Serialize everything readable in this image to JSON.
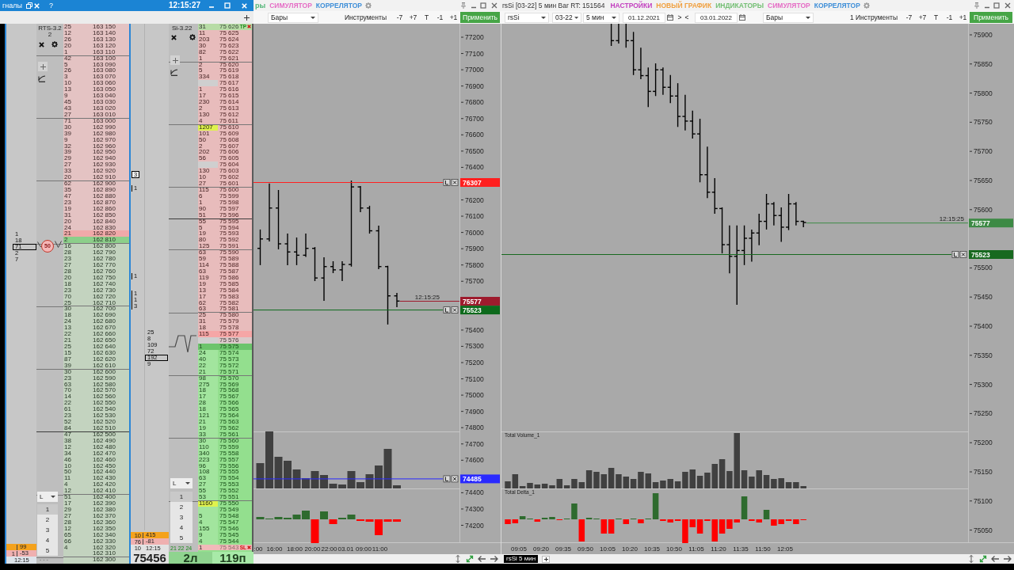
{
  "dom_window": {
    "title": "гналы",
    "help": "?",
    "clock": "12:15:27",
    "left_strip": {
      "cluster": [
        {
          "value": "1",
          "selected": false
        },
        {
          "value": "18",
          "selected": false
        },
        {
          "value": "71",
          "selected": true
        },
        {
          "value": "2",
          "selected": false
        },
        {
          "value": "7",
          "selected": false
        }
      ],
      "totals": [
        {
          "kind": "buy",
          "value": "99"
        },
        {
          "kind": "sell",
          "count": "1",
          "value": "-53"
        }
      ],
      "time": "12:15"
    },
    "rts": {
      "instrument": "RTS-3.22",
      "badge": "50",
      "mode": "L",
      "levels": [
        {
          "label": "1",
          "selected": true
        },
        {
          "label": "2",
          "selected": false
        },
        {
          "label": "3",
          "selected": false
        },
        {
          "label": "4",
          "selected": false
        },
        {
          "label": "5",
          "selected": false
        }
      ],
      "footer": "- - -",
      "ladder": {
        "active": false,
        "rows": [
          {
            "volume": "25",
            "price": "163 150",
            "kind": "ask"
          },
          {
            "volume": "12",
            "price": "163 140",
            "kind": "ask"
          },
          {
            "volume": "26",
            "price": "163 130",
            "kind": "ask"
          },
          {
            "volume": "20",
            "price": "163 120",
            "kind": "ask"
          },
          {
            "volume": "1",
            "price": "163 110",
            "kind": "ask"
          },
          {
            "volume": "42",
            "price": "163 100",
            "kind": "ask"
          },
          {
            "volume": "5",
            "price": "163 090",
            "kind": "ask"
          },
          {
            "volume": "26",
            "price": "163 080",
            "kind": "ask"
          },
          {
            "volume": "3",
            "price": "163 070",
            "kind": "ask"
          },
          {
            "volume": "10",
            "price": "163 060",
            "kind": "ask"
          },
          {
            "volume": "13",
            "price": "163 050",
            "kind": "ask"
          },
          {
            "volume": "9",
            "price": "163 040",
            "kind": "ask"
          },
          {
            "volume": "45",
            "price": "163 030",
            "kind": "ask"
          },
          {
            "volume": "43",
            "price": "163 020",
            "kind": "ask"
          },
          {
            "volume": "27",
            "price": "163 010",
            "kind": "ask"
          },
          {
            "volume": "71",
            "price": "163 000",
            "kind": "ask"
          },
          {
            "volume": "30",
            "price": "162 990",
            "kind": "ask"
          },
          {
            "volume": "39",
            "price": "162 980",
            "kind": "ask"
          },
          {
            "volume": "9",
            "price": "162 970",
            "kind": "ask"
          },
          {
            "volume": "32",
            "price": "162 960",
            "kind": "ask"
          },
          {
            "volume": "39",
            "price": "162 950",
            "kind": "ask"
          },
          {
            "volume": "29",
            "price": "162 940",
            "kind": "ask"
          },
          {
            "volume": "27",
            "price": "162 930",
            "kind": "ask"
          },
          {
            "volume": "33",
            "price": "162 920",
            "kind": "ask"
          },
          {
            "volume": "20",
            "price": "162 910",
            "kind": "ask"
          },
          {
            "volume": "62",
            "price": "162 900",
            "kind": "ask"
          },
          {
            "volume": "35",
            "price": "162 890",
            "kind": "ask"
          },
          {
            "volume": "47",
            "price": "162 880",
            "kind": "ask"
          },
          {
            "volume": "23",
            "price": "162 870",
            "kind": "ask"
          },
          {
            "volume": "19",
            "price": "162 860",
            "kind": "ask"
          },
          {
            "volume": "31",
            "price": "162 850",
            "kind": "ask"
          },
          {
            "volume": "20",
            "price": "162 840",
            "kind": "ask"
          },
          {
            "volume": "24",
            "price": "162 830",
            "kind": "ask"
          },
          {
            "volume": "21",
            "price": "162 820",
            "kind": "best_ask"
          },
          {
            "volume": "2",
            "price": "162 810",
            "kind": "best_bid"
          },
          {
            "volume": "16",
            "price": "162 800",
            "kind": "bid"
          },
          {
            "volume": "28",
            "price": "162 790",
            "kind": "bid"
          },
          {
            "volume": "23",
            "price": "162 780",
            "kind": "bid"
          },
          {
            "volume": "27",
            "price": "162 770",
            "kind": "bid"
          },
          {
            "volume": "28",
            "price": "162 760",
            "kind": "bid"
          },
          {
            "volume": "20",
            "price": "162 750",
            "kind": "bid"
          },
          {
            "volume": "18",
            "price": "162 740",
            "kind": "bid"
          },
          {
            "volume": "23",
            "price": "162 730",
            "kind": "bid"
          },
          {
            "volume": "70",
            "price": "162 720",
            "kind": "bid"
          },
          {
            "volume": "25",
            "price": "162 710",
            "kind": "bid"
          },
          {
            "volume": "30",
            "price": "162 700",
            "kind": "bid"
          },
          {
            "volume": "18",
            "price": "162 690",
            "kind": "bid"
          },
          {
            "volume": "24",
            "price": "162 680",
            "kind": "bid"
          },
          {
            "volume": "13",
            "price": "162 670",
            "kind": "bid"
          },
          {
            "volume": "22",
            "price": "162 660",
            "kind": "bid"
          },
          {
            "volume": "21",
            "price": "162 650",
            "kind": "bid"
          },
          {
            "volume": "25",
            "price": "162 640",
            "kind": "bid"
          },
          {
            "volume": "15",
            "price": "162 630",
            "kind": "bid"
          },
          {
            "volume": "87",
            "price": "162 620",
            "kind": "bid"
          },
          {
            "volume": "39",
            "price": "162 610",
            "kind": "bid"
          },
          {
            "volume": "30",
            "price": "162 600",
            "kind": "bid"
          },
          {
            "volume": "23",
            "price": "162 590",
            "kind": "bid"
          },
          {
            "volume": "63",
            "price": "162 580",
            "kind": "bid"
          },
          {
            "volume": "70",
            "price": "162 570",
            "kind": "bid"
          },
          {
            "volume": "14",
            "price": "162 560",
            "kind": "bid"
          },
          {
            "volume": "22",
            "price": "162 550",
            "kind": "bid"
          },
          {
            "volume": "61",
            "price": "162 540",
            "kind": "bid"
          },
          {
            "volume": "23",
            "price": "162 530",
            "kind": "bid"
          },
          {
            "volume": "52",
            "price": "162 520",
            "kind": "bid"
          },
          {
            "volume": "84",
            "price": "162 510",
            "kind": "bid"
          },
          {
            "volume": "47",
            "price": "162 500",
            "kind": "bid"
          },
          {
            "volume": "38",
            "price": "162 490",
            "kind": "bid"
          },
          {
            "volume": "12",
            "price": "162 480",
            "kind": "bid"
          },
          {
            "volume": "34",
            "price": "162 470",
            "kind": "bid"
          },
          {
            "volume": "46",
            "price": "162 460",
            "kind": "bid"
          },
          {
            "volume": "10",
            "price": "162 450",
            "kind": "bid"
          },
          {
            "volume": "50",
            "price": "162 440",
            "kind": "bid"
          },
          {
            "volume": "11",
            "price": "162 430",
            "kind": "bid"
          },
          {
            "volume": "4",
            "price": "162 420",
            "kind": "bid"
          },
          {
            "volume": "12",
            "price": "162 410",
            "kind": "bid"
          },
          {
            "volume": "51",
            "price": "162 400",
            "kind": "bid"
          },
          {
            "volume": "17",
            "price": "162 390",
            "kind": "bid"
          },
          {
            "volume": "29",
            "price": "162 380",
            "kind": "bid"
          },
          {
            "volume": "27",
            "price": "162 370",
            "kind": "bid"
          },
          {
            "volume": "28",
            "price": "162 360",
            "kind": "bid"
          },
          {
            "volume": "12",
            "price": "162 350",
            "kind": "bid"
          },
          {
            "volume": "65",
            "price": "162 340",
            "kind": "bid"
          },
          {
            "volume": "66",
            "price": "162 330",
            "kind": "bid"
          },
          {
            "volume": "4",
            "price": "162 320",
            "kind": "bid"
          },
          {
            "price": "162 310",
            "kind": "bid"
          },
          {
            "price": "162 300",
            "kind": "bid"
          }
        ]
      }
    },
    "tape": {
      "items": [
        {
          "value": "3",
          "selected": true
        },
        {
          "value": "1",
          "selected": false
        },
        {
          "value": "1",
          "selected": false
        },
        {
          "value": "1",
          "selected": false
        },
        {
          "value": "1",
          "selected": false
        },
        {
          "value": "3",
          "selected": false
        }
      ],
      "cluster": [
        {
          "value": "25",
          "selected": false
        },
        {
          "value": "8",
          "selected": false
        },
        {
          "value": "109",
          "selected": false
        },
        {
          "value": "72",
          "selected": false
        },
        {
          "value": "192",
          "selected": true
        },
        {
          "value": "9",
          "selected": false
        }
      ],
      "totals": [
        {
          "kind": "buy",
          "count": "10",
          "value": "415"
        },
        {
          "kind": "sell",
          "count": "76",
          "value": "-81"
        }
      ],
      "count": "10",
      "time": "12:15",
      "last_price": "75456"
    },
    "si": {
      "instrument": "Si-3.22",
      "mode": "L",
      "levels": [
        {
          "label": "1",
          "selected": true
        },
        {
          "label": "2",
          "selected": false
        },
        {
          "label": "3",
          "selected": false
        },
        {
          "label": "4",
          "selected": false
        },
        {
          "label": "5",
          "selected": false
        }
      ],
      "footer": "21 22 24",
      "ladder": {
        "active": true,
        "rows": [
          {
            "volume": "31",
            "price": "75 626",
            "kind": "ask",
            "order": {
              "kind": "take_profit",
              "label": "TP"
            }
          },
          {
            "volume": "11",
            "price": "75 625",
            "kind": "ask"
          },
          {
            "volume": "203",
            "price": "75 624",
            "kind": "ask"
          },
          {
            "volume": "30",
            "price": "75 623",
            "kind": "ask"
          },
          {
            "volume": "82",
            "price": "75 622",
            "kind": "ask"
          },
          {
            "volume": "1",
            "price": "75 621",
            "kind": "ask"
          },
          {
            "volume": "2",
            "price": "75 620",
            "kind": "ask"
          },
          {
            "volume": "5",
            "price": "75 619",
            "kind": "ask"
          },
          {
            "volume": "334",
            "price": "75 618",
            "kind": "ask"
          },
          {
            "price": "75 617",
            "kind": "ask"
          },
          {
            "volume": "1",
            "price": "75 616",
            "kind": "ask"
          },
          {
            "volume": "17",
            "price": "75 615",
            "kind": "ask"
          },
          {
            "volume": "230",
            "price": "75 614",
            "kind": "ask"
          },
          {
            "volume": "2",
            "price": "75 613",
            "kind": "ask"
          },
          {
            "volume": "130",
            "price": "75 612",
            "kind": "ask"
          },
          {
            "volume": "4",
            "price": "75 611",
            "kind": "ask"
          },
          {
            "volume": "1207",
            "price": "75 610",
            "kind": "big_ask"
          },
          {
            "volume": "101",
            "price": "75 609",
            "kind": "ask"
          },
          {
            "volume": "50",
            "price": "75 608",
            "kind": "ask"
          },
          {
            "volume": "2",
            "price": "75 607",
            "kind": "ask"
          },
          {
            "volume": "202",
            "price": "75 606",
            "kind": "ask"
          },
          {
            "volume": "56",
            "price": "75 605",
            "kind": "ask"
          },
          {
            "price": "75 604",
            "kind": "ask"
          },
          {
            "volume": "130",
            "price": "75 603",
            "kind": "ask"
          },
          {
            "volume": "10",
            "price": "75 602",
            "kind": "ask"
          },
          {
            "volume": "27",
            "price": "75 601",
            "kind": "ask"
          },
          {
            "volume": "115",
            "price": "75 600",
            "kind": "ask"
          },
          {
            "volume": "6",
            "price": "75 599",
            "kind": "ask"
          },
          {
            "volume": "1",
            "price": "75 598",
            "kind": "ask"
          },
          {
            "volume": "90",
            "price": "75 597",
            "kind": "ask"
          },
          {
            "volume": "51",
            "price": "75 596",
            "kind": "ask"
          },
          {
            "volume": "55",
            "price": "75 595",
            "kind": "ask"
          },
          {
            "volume": "5",
            "price": "75 594",
            "kind": "ask"
          },
          {
            "volume": "19",
            "price": "75 593",
            "kind": "ask"
          },
          {
            "volume": "80",
            "price": "75 592",
            "kind": "ask"
          },
          {
            "volume": "125",
            "price": "75 591",
            "kind": "ask"
          },
          {
            "volume": "63",
            "price": "75 590",
            "kind": "ask"
          },
          {
            "volume": "59",
            "price": "75 589",
            "kind": "ask"
          },
          {
            "volume": "114",
            "price": "75 588",
            "kind": "ask"
          },
          {
            "volume": "63",
            "price": "75 587",
            "kind": "ask"
          },
          {
            "volume": "119",
            "price": "75 586",
            "kind": "ask"
          },
          {
            "volume": "19",
            "price": "75 585",
            "kind": "ask"
          },
          {
            "volume": "13",
            "price": "75 584",
            "kind": "ask"
          },
          {
            "volume": "17",
            "price": "75 583",
            "kind": "ask"
          },
          {
            "volume": "62",
            "price": "75 582",
            "kind": "ask"
          },
          {
            "volume": "63",
            "price": "75 581",
            "kind": "ask"
          },
          {
            "volume": "25",
            "price": "75 580",
            "kind": "ask"
          },
          {
            "volume": "31",
            "price": "75 579",
            "kind": "ask"
          },
          {
            "volume": "18",
            "price": "75 578",
            "kind": "ask"
          },
          {
            "volume": "115",
            "price": "75 577",
            "kind": "best_ask"
          },
          {
            "price": "75 576",
            "kind": "spread"
          },
          {
            "volume": "1",
            "price": "75 575",
            "kind": "best_bid"
          },
          {
            "volume": "24",
            "price": "75 574",
            "kind": "bid"
          },
          {
            "volume": "40",
            "price": "75 573",
            "kind": "bid"
          },
          {
            "volume": "22",
            "price": "75 572",
            "kind": "bid"
          },
          {
            "volume": "21",
            "price": "75 571",
            "kind": "bid"
          },
          {
            "volume": "98",
            "price": "75 570",
            "kind": "bid"
          },
          {
            "volume": "275",
            "price": "75 569",
            "kind": "bid"
          },
          {
            "volume": "18",
            "price": "75 568",
            "kind": "bid"
          },
          {
            "volume": "17",
            "price": "75 567",
            "kind": "bid"
          },
          {
            "volume": "28",
            "price": "75 566",
            "kind": "bid"
          },
          {
            "volume": "18",
            "price": "75 565",
            "kind": "bid"
          },
          {
            "volume": "121",
            "price": "75 564",
            "kind": "bid"
          },
          {
            "volume": "21",
            "price": "75 563",
            "kind": "bid"
          },
          {
            "volume": "19",
            "price": "75 562",
            "kind": "bid"
          },
          {
            "volume": "33",
            "price": "75 561",
            "kind": "bid"
          },
          {
            "volume": "30",
            "price": "75 560",
            "kind": "bid"
          },
          {
            "volume": "110",
            "price": "75 559",
            "kind": "bid"
          },
          {
            "volume": "340",
            "price": "75 558",
            "kind": "bid"
          },
          {
            "volume": "223",
            "price": "75 557",
            "kind": "bid"
          },
          {
            "volume": "96",
            "price": "75 556",
            "kind": "bid"
          },
          {
            "volume": "108",
            "price": "75 555",
            "kind": "bid"
          },
          {
            "volume": "63",
            "price": "75 554",
            "kind": "bid"
          },
          {
            "volume": "27",
            "price": "75 553",
            "kind": "bid"
          },
          {
            "volume": "55",
            "price": "75 552",
            "kind": "bid"
          },
          {
            "volume": "53",
            "price": "75 551",
            "kind": "bid"
          },
          {
            "volume": "1160",
            "price": "75 550",
            "kind": "big_bid"
          },
          {
            "price": "75 549",
            "kind": "bid"
          },
          {
            "volume": "5",
            "price": "75 548",
            "kind": "bid"
          },
          {
            "volume": "4",
            "price": "75 547",
            "kind": "bid"
          },
          {
            "volume": "155",
            "price": "75 546",
            "kind": "bid"
          },
          {
            "volume": "9",
            "price": "75 545",
            "kind": "bid"
          },
          {
            "volume": "4",
            "price": "75 544",
            "kind": "bid"
          },
          {
            "volume": "1",
            "price": "75 543",
            "kind": "bid",
            "order": {
              "kind": "stop_loss",
              "label": "SL"
            }
          }
        ]
      },
      "lots": "2л",
      "points": "119п"
    }
  },
  "chart_left": {
    "menu": [
      {
        "label": "ры",
        "color": "#55b77a"
      },
      {
        "label": "СИМУЛЯТОР",
        "color": "#e56cc5"
      },
      {
        "label": "КОРРЕЛЯТОР",
        "color": "#3f8fd8"
      }
    ],
    "toolbar": {
      "chart_type": "Бары",
      "instruments": "Инструменты",
      "steps": [
        "-7",
        "+7",
        "T",
        "-1",
        "+1"
      ],
      "apply": "Применить"
    },
    "price_axis": [
      "77200",
      "77100",
      "77000",
      "76900",
      "76800",
      "76700",
      "76600",
      "76500",
      "76400",
      "76200",
      "76100",
      "76000",
      "75900",
      "75800",
      "75700",
      "75400",
      "75300",
      "75200",
      "75100",
      "75000",
      "74900",
      "74800",
      "74700",
      "74600",
      "74400",
      "74300",
      "74200"
    ],
    "time_axis": [
      ":00",
      "16:00",
      "18:00",
      "20:00",
      "22:00",
      "03.01",
      "09:00",
      "11:00"
    ],
    "price_lines": [
      {
        "kind": "level",
        "label": "76307",
        "color": "#ff1f1f"
      },
      {
        "kind": "last",
        "label": "75577",
        "color": "#9e1b2d",
        "time": "12:15:25"
      },
      {
        "kind": "level",
        "label": "75523",
        "color": "#0d6a1c"
      },
      {
        "kind": "level",
        "label": "74485",
        "color": "#2a2aff"
      }
    ]
  },
  "chart_right": {
    "title": "rsSi [03-22] 5 мин Bar RT: 151564",
    "menu": [
      {
        "label": "НАСТРОЙКИ",
        "color": "#c23fbf"
      },
      {
        "label": "НОВЫЙ ГРАФИК",
        "color": "#f0a040"
      },
      {
        "label": "ИНДИКАТОРЫ",
        "color": "#74bf74"
      },
      {
        "label": "СИМУЛЯТОР",
        "color": "#e56cc5"
      },
      {
        "label": "КОРРЕЛЯТОР",
        "color": "#3f8fd8"
      }
    ],
    "toolbar": {
      "symbol": "rsSi",
      "contract": "03-22",
      "timeframe": "5 мин",
      "date_from": "01.12.2021",
      "next": ">",
      "prev": "<",
      "date_to": "03.01.2022",
      "chart_type": "Бары",
      "instruments": "1 Инструменты",
      "steps": [
        "-7",
        "+7",
        "T",
        "-1",
        "+1"
      ],
      "apply": "Применить"
    },
    "price_axis": [
      "75900",
      "75850",
      "75800",
      "75750",
      "75700",
      "75650",
      "75600",
      "75500",
      "75450",
      "75400",
      "75350",
      "75300",
      "75250",
      "75200",
      "75150",
      "75100",
      "75050"
    ],
    "time_axis": [
      "09:05",
      "09:20",
      "09:35",
      "09:50",
      "10:05",
      "10:20",
      "10:35",
      "10:50",
      "11:05",
      "11:20",
      "11:35",
      "11:50",
      "12:05"
    ],
    "price_lines": [
      {
        "kind": "last",
        "label": "75577",
        "color": "#3d8a45",
        "time": "12:15:25"
      },
      {
        "kind": "level",
        "label": "75523",
        "color": "#17691f"
      }
    ],
    "volume_pane": {
      "title": "Total Volume_1"
    },
    "delta_pane": {
      "title": "Total Delta_1"
    },
    "tabs": [
      {
        "label": "rsSi 5 мин",
        "selected": true
      }
    ]
  }
}
